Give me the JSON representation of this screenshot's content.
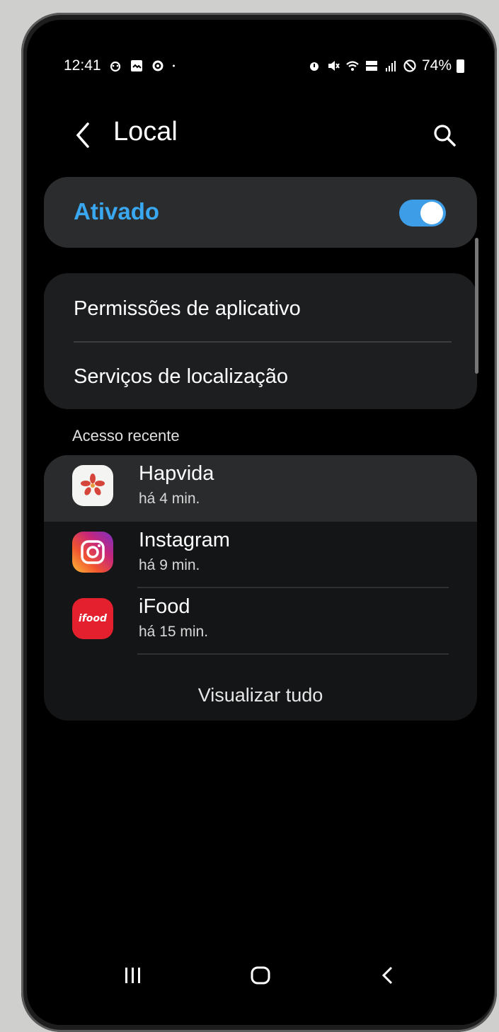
{
  "status_bar": {
    "time": "12:41",
    "battery": "74%",
    "left_icons": [
      "notification-face-icon",
      "gallery-icon",
      "settings-gear-icon",
      "dot-icon"
    ],
    "right_icons": [
      "alarm-icon",
      "mute-icon",
      "wifi-icon",
      "volte-icon",
      "signal-icon",
      "do-not-disturb-icon",
      "battery-icon"
    ]
  },
  "header": {
    "title": "Local",
    "back_icon": "back-chevron-icon",
    "search_icon": "search-icon"
  },
  "master_toggle": {
    "label": "Ativado",
    "checked": true,
    "accent": "#3aa8f0"
  },
  "menu": {
    "items": [
      {
        "label": "Permissões de aplicativo"
      },
      {
        "label": "Serviços de localização"
      }
    ]
  },
  "recent": {
    "section_label": "Acesso recente",
    "apps": [
      {
        "name": "Hapvida",
        "time": "há 4 min.",
        "icon": "hapvida-icon"
      },
      {
        "name": "Instagram",
        "time": "há 9 min.",
        "icon": "instagram-icon"
      },
      {
        "name": "iFood",
        "time": "há 15 min.",
        "icon": "ifood-icon",
        "logo_text": "ifood"
      }
    ],
    "view_all_label": "Visualizar tudo"
  },
  "nav_bar": {
    "icons": [
      "recents-icon",
      "home-icon",
      "back-icon"
    ]
  }
}
